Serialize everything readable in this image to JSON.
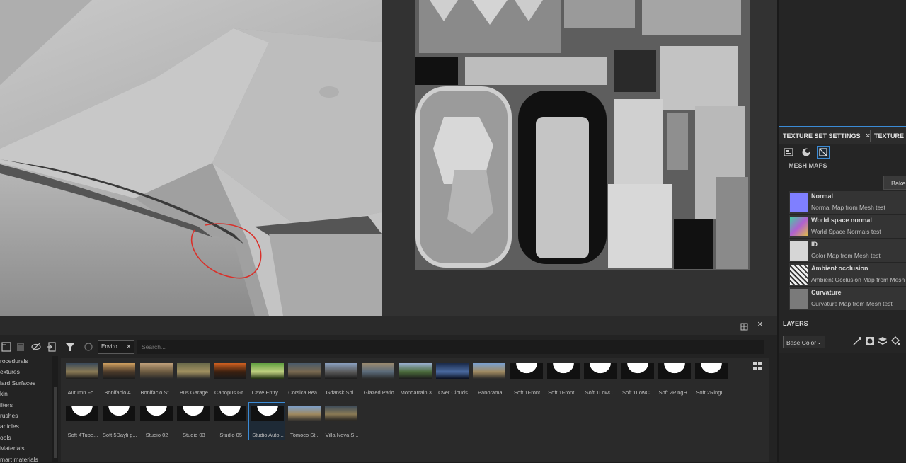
{
  "right_panel": {
    "tabs": [
      {
        "label": "TEXTURE SET SETTINGS",
        "close": "×"
      },
      {
        "label": "TEXTURE S"
      }
    ],
    "mesh_maps_title": "MESH MAPS",
    "bake_label": "Bake M",
    "mesh_maps": [
      {
        "name": "Normal",
        "desc": "Normal Map from Mesh test",
        "thumb_color": "#7f7fff"
      },
      {
        "name": "World space normal",
        "desc": "World Space Normals test",
        "thumb_color": "#b070c0"
      },
      {
        "name": "ID",
        "desc": "Color Map from Mesh test",
        "thumb_color": "#d6d6d6"
      },
      {
        "name": "Ambient occlusion",
        "desc": "Ambient Occlusion Map from Mesh tes",
        "thumb_color": "#9a9a9a"
      },
      {
        "name": "Curvature",
        "desc": "Curvature Map from Mesh test",
        "thumb_color": "#7a7a7a"
      }
    ],
    "layers_title": "LAYERS",
    "layers_channel": "Base Color"
  },
  "shelf": {
    "filter_chip": "Enviro",
    "filter_chip_close": "×",
    "search_placeholder": "Search...",
    "close_label": "×",
    "categories": [
      "rocedurals",
      "extures",
      "lard Surfaces",
      "kin",
      "ilters",
      "rushes",
      "articles",
      "ools",
      "Materials",
      "mart materials"
    ],
    "assets_row1": [
      {
        "label": "Autumn Fo...",
        "kind": "hdr"
      },
      {
        "label": "Bonifacio A...",
        "kind": "hdr"
      },
      {
        "label": "Bonifacio St...",
        "kind": "hdr"
      },
      {
        "label": "Bus Garage",
        "kind": "hdr"
      },
      {
        "label": "Canopus Gr...",
        "kind": "hdr"
      },
      {
        "label": "Cave Entry ...",
        "kind": "hdr"
      },
      {
        "label": "Corsica Bea...",
        "kind": "hdr"
      },
      {
        "label": "Gdansk Shi...",
        "kind": "hdr"
      },
      {
        "label": "Glazed Patio",
        "kind": "hdr"
      },
      {
        "label": "Mondarrain 3",
        "kind": "hdr"
      },
      {
        "label": "Over Clouds",
        "kind": "hdr"
      },
      {
        "label": "Panorama",
        "kind": "hdr"
      },
      {
        "label": "Soft 1Front",
        "kind": "studio"
      },
      {
        "label": "Soft 1Front ...",
        "kind": "studio"
      },
      {
        "label": "Soft 1LowC...",
        "kind": "studio"
      },
      {
        "label": "Soft 1LowC...",
        "kind": "studio"
      },
      {
        "label": "Soft 2RingH...",
        "kind": "studio"
      },
      {
        "label": "Soft 2RingL...",
        "kind": "studio"
      }
    ],
    "assets_row2": [
      {
        "label": "Soft 4Tube...",
        "kind": "studio"
      },
      {
        "label": "Soft 5Dayli g...",
        "kind": "studio"
      },
      {
        "label": "Studio 02",
        "kind": "studio"
      },
      {
        "label": "Studio 03",
        "kind": "studio"
      },
      {
        "label": "Studio 05",
        "kind": "studio"
      },
      {
        "label": "Studio Auto...",
        "kind": "studio",
        "selected": true
      },
      {
        "label": "Tomoco St...",
        "kind": "hdr"
      },
      {
        "label": "Villa Nova S...",
        "kind": "hdr"
      }
    ]
  }
}
